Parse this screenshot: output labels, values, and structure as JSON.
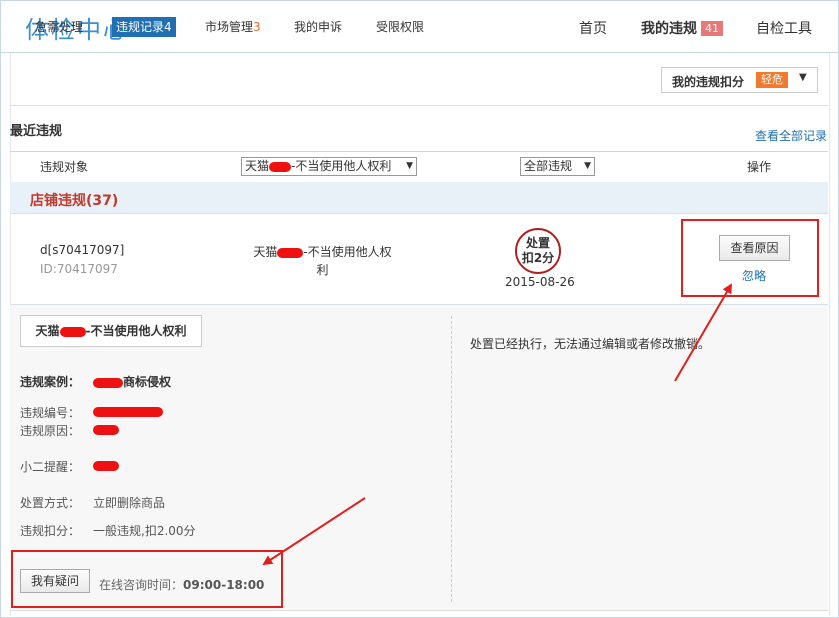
{
  "header": {
    "logo": "体检中心",
    "nav": [
      {
        "label": "首页"
      },
      {
        "label": "我的违规",
        "badge": "41"
      },
      {
        "label": "自检工具"
      }
    ]
  },
  "tabs": [
    {
      "label": "急需处理",
      "count": ""
    },
    {
      "label": "违规记录",
      "count": "4",
      "active": true
    },
    {
      "label": "市场管理",
      "count": "3"
    },
    {
      "label": "我的申诉",
      "count": ""
    },
    {
      "label": "受限权限",
      "count": ""
    }
  ],
  "deduction": {
    "label": "我的违规扣分",
    "level": "轻危",
    "arrow_icon": "triangle-down-icon"
  },
  "section": {
    "title": "最近违规",
    "view_all": "查看全部记录"
  },
  "table": {
    "col_object": "违规对象",
    "filter1": {
      "prefix": "天猫",
      "suffix": "-不当使用他人权利"
    },
    "filter2": "全部违规",
    "col_action": "操作"
  },
  "store_group": {
    "title": "店铺违规(37)"
  },
  "record": {
    "id_line": "d[s70417097]",
    "id_sub": "ID:70417097",
    "type_prefix": "天猫",
    "type_suffix": "-不当使用他人权",
    "type_line2": "利",
    "stamp": [
      "处置",
      "扣2分"
    ],
    "date": "2015-08-26",
    "view_reason": "查看原因",
    "ignore": "忽略"
  },
  "detail": {
    "title_prefix": "天猫",
    "title_suffix": "-不当使用他人权利",
    "case_label": "违规案例：",
    "case_value": "商标侵权",
    "number_label": "违规编号：",
    "reason_label": "违规原因：",
    "reminder_label": "小二提醒：",
    "method_label": "处置方式：",
    "method_value": "立即删除商品",
    "points_label": "违规扣分：",
    "points_value": "一般违规,扣2.00分",
    "question_button": "我有疑问",
    "hours_label": "在线咨询时间：",
    "hours_value": "09:00-18:00",
    "notice": "处置已经执行，无法通过编辑或者修改撤销。"
  },
  "colors": {
    "accent": "#1f6fb2",
    "logo": "#3b8fd0",
    "warning": "#c0392b",
    "annotation": "#e0201e"
  }
}
